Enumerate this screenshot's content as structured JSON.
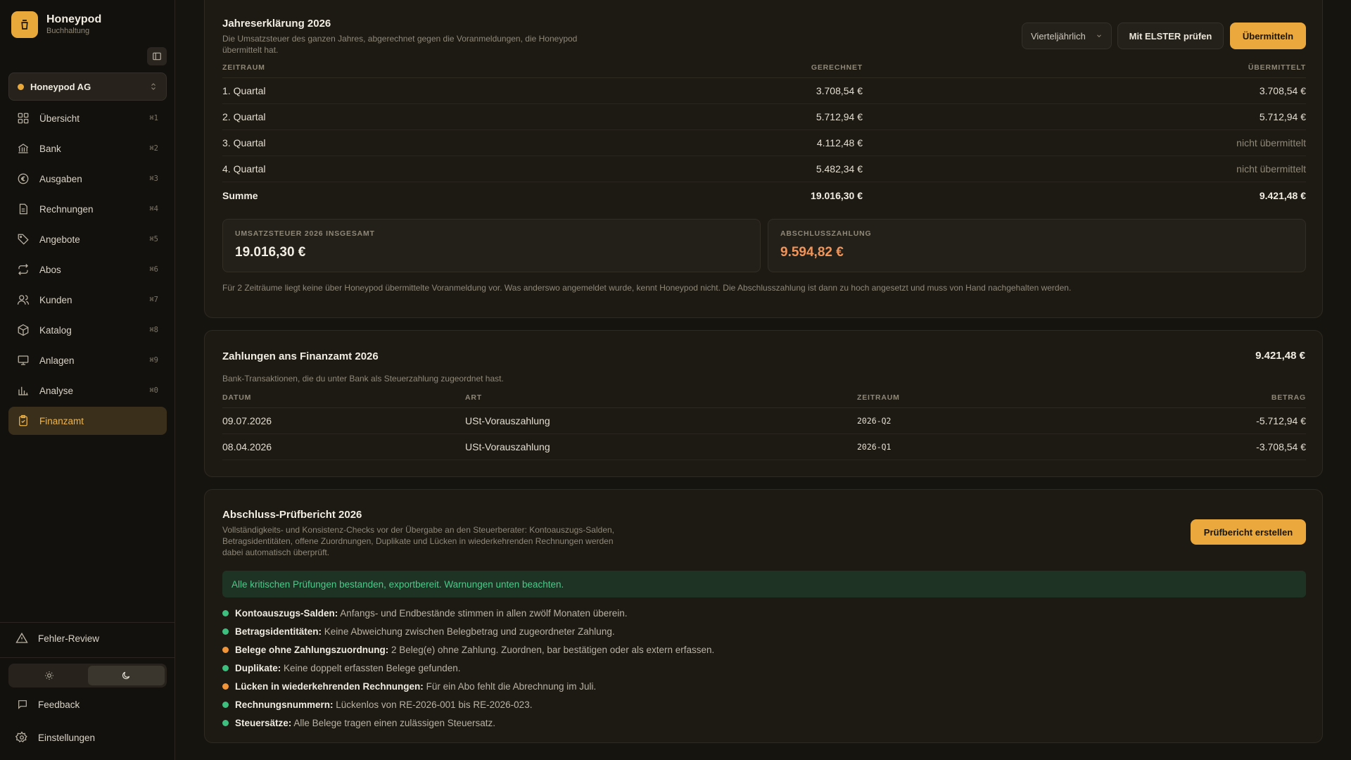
{
  "brand": {
    "name": "Honeypod",
    "sub": "Buchhaltung"
  },
  "company": {
    "name": "Honeypod AG"
  },
  "nav": [
    {
      "label": "Übersicht",
      "kbd": "⌘1",
      "icon": "grid-icon"
    },
    {
      "label": "Bank",
      "kbd": "⌘2",
      "icon": "bank-icon"
    },
    {
      "label": "Ausgaben",
      "kbd": "⌘3",
      "icon": "euro-circle-icon"
    },
    {
      "label": "Rechnungen",
      "kbd": "⌘4",
      "icon": "document-icon"
    },
    {
      "label": "Angebote",
      "kbd": "⌘5",
      "icon": "tag-icon"
    },
    {
      "label": "Abos",
      "kbd": "⌘6",
      "icon": "repeat-icon"
    },
    {
      "label": "Kunden",
      "kbd": "⌘7",
      "icon": "users-icon"
    },
    {
      "label": "Katalog",
      "kbd": "⌘8",
      "icon": "box-icon"
    },
    {
      "label": "Anlagen",
      "kbd": "⌘9",
      "icon": "monitor-icon"
    },
    {
      "label": "Analyse",
      "kbd": "⌘0",
      "icon": "chart-icon"
    },
    {
      "label": "Finanzamt",
      "kbd": "",
      "icon": "clipboard-icon",
      "active": true
    }
  ],
  "bottom": {
    "review": "Fehler-Review",
    "feedback": "Feedback",
    "settings": "Einstellungen"
  },
  "annual": {
    "title": "Jahreserklärung 2026",
    "desc": "Die Umsatzsteuer des ganzen Jahres, abgerechnet gegen die Voranmeldungen, die Honeypod übermittelt hat.",
    "period_select": "Vierteljährlich",
    "elster_btn": "Mit ELSTER prüfen",
    "submit_btn": "Übermitteln",
    "headers": {
      "period": "ZEITRAUM",
      "computed": "GERECHNET",
      "submitted": "ÜBERMITTELT"
    },
    "rows": [
      {
        "period": "1. Quartal",
        "computed": "3.708,54 €",
        "submitted": "3.708,54 €",
        "muted": false
      },
      {
        "period": "2. Quartal",
        "computed": "5.712,94 €",
        "submitted": "5.712,94 €",
        "muted": false
      },
      {
        "period": "3. Quartal",
        "computed": "4.112,48 €",
        "submitted": "nicht übermittelt",
        "muted": true
      },
      {
        "period": "4. Quartal",
        "computed": "5.482,34 €",
        "submitted": "nicht übermittelt",
        "muted": true
      }
    ],
    "sum": {
      "label": "Summe",
      "computed": "19.016,30 €",
      "submitted": "9.421,48 €"
    },
    "total_label": "UMSATZSTEUER 2026 INSGESAMT",
    "total_value": "19.016,30 €",
    "final_label": "ABSCHLUSSZAHLUNG",
    "final_value": "9.594,82 €",
    "note": "Für 2 Zeiträume liegt keine über Honeypod übermittelte Voranmeldung vor. Was anderswo angemeldet wurde, kennt Honeypod nicht. Die Abschlusszahlung ist dann zu hoch angesetzt und muss von Hand nachgehalten werden."
  },
  "payments": {
    "title": "Zahlungen ans Finanzamt 2026",
    "total": "9.421,48 €",
    "desc": "Bank-Transaktionen, die du unter Bank als Steuerzahlung zugeordnet hast.",
    "headers": {
      "date": "DATUM",
      "type": "ART",
      "period": "ZEITRAUM",
      "amount": "BETRAG"
    },
    "rows": [
      {
        "date": "09.07.2026",
        "type": "USt-Vorauszahlung",
        "period": "2026-Q2",
        "amount": "-5.712,94 €"
      },
      {
        "date": "08.04.2026",
        "type": "USt-Vorauszahlung",
        "period": "2026-Q1",
        "amount": "-3.708,54 €"
      }
    ]
  },
  "report": {
    "title": "Abschluss-Prüfbericht 2026",
    "desc": "Vollständigkeits- und Konsistenz-Checks vor der Übergabe an den Steuerberater: Kontoauszugs-Salden, Betragsidentitäten, offene Zuordnungen, Duplikate und Lücken in wiederkehrenden Rechnungen werden dabei automatisch überprüft.",
    "create_btn": "Prüfbericht erstellen",
    "banner": "Alle kritischen Prüfungen bestanden, exportbereit. Warnungen unten beachten.",
    "checks": [
      {
        "title": "Kontoauszugs-Salden:",
        "text": "Anfangs- und Endbestände stimmen in allen zwölf Monaten überein.",
        "status": "ok"
      },
      {
        "title": "Betragsidentitäten:",
        "text": "Keine Abweichung zwischen Belegbetrag und zugeordneter Zahlung.",
        "status": "ok"
      },
      {
        "title": "Belege ohne Zahlungszuordnung:",
        "text": "2 Beleg(e) ohne Zahlung. Zuordnen, bar bestätigen oder als extern erfassen.",
        "status": "warn"
      },
      {
        "title": "Duplikate:",
        "text": "Keine doppelt erfassten Belege gefunden.",
        "status": "ok"
      },
      {
        "title": "Lücken in wiederkehrenden Rechnungen:",
        "text": "Für ein Abo fehlt die Abrechnung im Juli.",
        "status": "warn"
      },
      {
        "title": "Rechnungsnummern:",
        "text": "Lückenlos von RE-2026-001 bis RE-2026-023.",
        "status": "ok"
      },
      {
        "title": "Steuersätze:",
        "text": "Alle Belege tragen einen zulässigen Steuersatz.",
        "status": "ok"
      }
    ]
  },
  "colors": {
    "accent": "#eba83c",
    "ok": "#3fbf7f",
    "warn": "#f0953a",
    "final": "#f0955a"
  }
}
